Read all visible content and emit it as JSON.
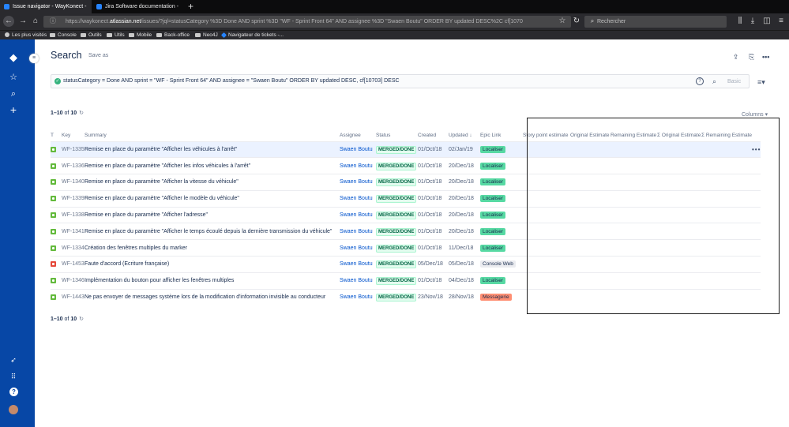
{
  "browser": {
    "tabs": [
      {
        "title": "Issue navigator - WayKonect -",
        "fav_color": "#2684ff"
      },
      {
        "title": "Jira Software documentation -",
        "fav_color": "#2684ff"
      }
    ],
    "url_prefix": "https://waykonect.",
    "url_domain": "atlassian.net",
    "url_rest": "/issues/?jql=statusCategory %3D Done AND sprint %3D \"WF - Sprint Front 64\" AND assignee %3D \"Swaen Boutu\" ORDER BY updated DESC%2C cf[1070",
    "search_placeholder": "Rechercher",
    "bookmarks": [
      "Les plus visités",
      "Console",
      "Outils",
      "Utils",
      "Mobile",
      "Back-office",
      "Neo4J",
      "Navigateur de tickets -..."
    ]
  },
  "page": {
    "title": "Search",
    "save_as": "Save as",
    "jql": "statusCategory = Done AND sprint = \"WF - Sprint Front 64\" AND assignee = \"Swaen Boutu\" ORDER BY updated DESC, cf[10703] DESC",
    "basic": "Basic",
    "count_top": {
      "range": "1–10",
      "of": "of",
      "total": "10"
    },
    "count_bottom": {
      "range": "1–10",
      "of": "of",
      "total": "10"
    },
    "columns_label": "Columns"
  },
  "table": {
    "headers": {
      "t": "T",
      "key": "Key",
      "summary": "Summary",
      "assignee": "Assignee",
      "status": "Status",
      "created": "Created",
      "updated": "Updated",
      "epic": "Epic Link",
      "sp": "Story point estimate",
      "oe": "Original Estimate",
      "re": "Remaining Estimate",
      "soe": "Σ Original Estimate",
      "sre": "Σ Remaining Estimate"
    },
    "rows": [
      {
        "type": "story",
        "key": "WF-1335",
        "summary": "Remise en place du paramètre \"Afficher les véhicules à l'arrêt\"",
        "assignee": "Swaen Boutu",
        "status": "MERGED/DONE",
        "created": "01/Oct/18",
        "updated": "02/Jan/19",
        "epic": "Localiser",
        "epic_bg": "#57d9a3"
      },
      {
        "type": "story",
        "key": "WF-1336",
        "summary": "Remise en place du paramètre \"Afficher les infos véhicules à l'arrêt\"",
        "assignee": "Swaen Boutu",
        "status": "MERGED/DONE",
        "created": "01/Oct/18",
        "updated": "20/Dec/18",
        "epic": "Localiser",
        "epic_bg": "#57d9a3"
      },
      {
        "type": "story",
        "key": "WF-1340",
        "summary": "Remise en place du paramètre \"Afficher la vitesse du véhicule\"",
        "assignee": "Swaen Boutu",
        "status": "MERGED/DONE",
        "created": "01/Oct/18",
        "updated": "20/Dec/18",
        "epic": "Localiser",
        "epic_bg": "#57d9a3"
      },
      {
        "type": "story",
        "key": "WF-1339",
        "summary": "Remise en place du paramètre \"Afficher le modèle du véhicule\"",
        "assignee": "Swaen Boutu",
        "status": "MERGED/DONE",
        "created": "01/Oct/18",
        "updated": "20/Dec/18",
        "epic": "Localiser",
        "epic_bg": "#57d9a3"
      },
      {
        "type": "story",
        "key": "WF-1338",
        "summary": "Remise en place du paramètre \"Afficher l'adresse\"",
        "assignee": "Swaen Boutu",
        "status": "MERGED/DONE",
        "created": "01/Oct/18",
        "updated": "20/Dec/18",
        "epic": "Localiser",
        "epic_bg": "#57d9a3"
      },
      {
        "type": "story",
        "key": "WF-1341",
        "summary": "Remise en place du paramètre \"Afficher le temps écoulé depuis la dernière transmission du véhicule\"",
        "assignee": "Swaen Boutu",
        "status": "MERGED/DONE",
        "created": "01/Oct/18",
        "updated": "20/Dec/18",
        "epic": "Localiser",
        "epic_bg": "#57d9a3"
      },
      {
        "type": "story",
        "key": "WF-1334",
        "summary": "Création des fenêtres multiples du marker",
        "assignee": "Swaen Boutu",
        "status": "MERGED/DONE",
        "created": "01/Oct/18",
        "updated": "11/Dec/18",
        "epic": "Localiser",
        "epic_bg": "#57d9a3"
      },
      {
        "type": "bug",
        "key": "WF-1453",
        "summary": "Faute d'accord (Ecriture française)",
        "assignee": "Swaen Boutu",
        "status": "MERGED/DONE",
        "created": "05/Dec/18",
        "updated": "05/Dec/18",
        "epic": "Console Web",
        "epic_bg": "#ebecf0"
      },
      {
        "type": "story",
        "key": "WF-1346",
        "summary": "Implémentation du bouton pour afficher les fenêtres multiples",
        "assignee": "Swaen Boutu",
        "status": "MERGED/DONE",
        "created": "01/Oct/18",
        "updated": "04/Dec/18",
        "epic": "Localiser",
        "epic_bg": "#57d9a3"
      },
      {
        "type": "story",
        "key": "WF-1443",
        "summary": "Ne pas envoyer de messages système lors de la modification d'information invisible au conducteur",
        "assignee": "Swaen Boutu",
        "status": "MERGED/DONE",
        "created": "23/Nov/18",
        "updated": "28/Nov/18",
        "epic": "Messagerie",
        "epic_bg": "#ff8f73"
      }
    ]
  }
}
